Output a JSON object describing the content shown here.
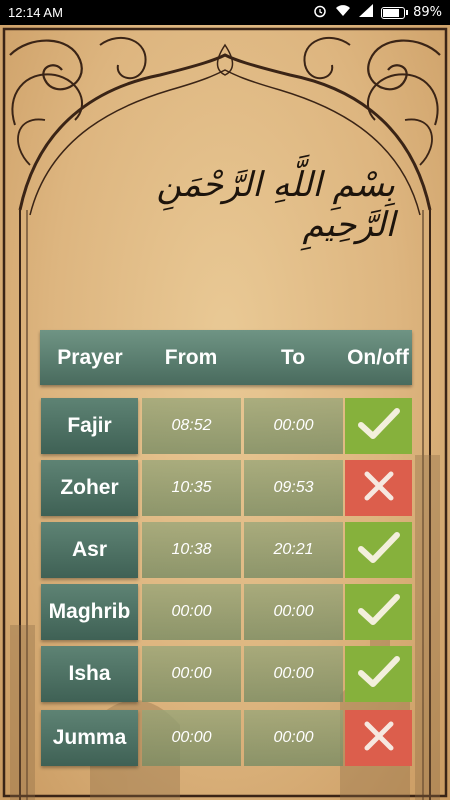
{
  "status_bar": {
    "time": "12:14 AM",
    "battery": "89%",
    "battery_level": 0.89,
    "icons": [
      "alarm-icon",
      "wifi-icon",
      "signal-icon",
      "battery-icon"
    ]
  },
  "basmala": "بِسْمِ اللَّهِ الرَّحْمَنِ الرَّحِيمِ",
  "table": {
    "headers": {
      "prayer": "Prayer",
      "from": "From",
      "to": "To",
      "onoff": "On/off"
    },
    "rows": [
      {
        "name": "Fajir",
        "from": "08:52",
        "to": "00:00",
        "enabled": true
      },
      {
        "name": "Zoher",
        "from": "10:35",
        "to": "09:53",
        "enabled": false
      },
      {
        "name": "Asr",
        "from": "10:38",
        "to": "20:21",
        "enabled": true
      },
      {
        "name": "Maghrib",
        "from": "00:00",
        "to": "00:00",
        "enabled": true
      },
      {
        "name": "Isha",
        "from": "00:00",
        "to": "00:00",
        "enabled": true
      },
      {
        "name": "Jumma",
        "from": "00:00",
        "to": "00:00",
        "enabled": false
      }
    ]
  },
  "colors": {
    "on": "#86b13c",
    "off": "#dc5e4c",
    "header": "#5e8374",
    "parchment": "#ddb57f"
  }
}
